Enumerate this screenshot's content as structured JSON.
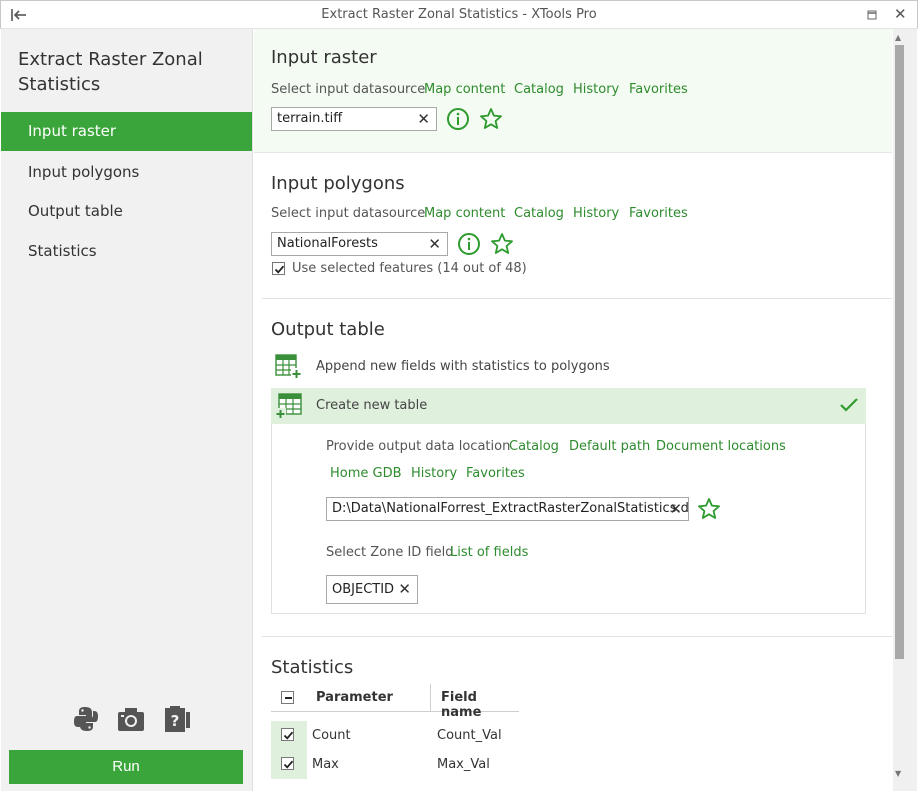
{
  "window": {
    "title": "Extract Raster Zonal Statistics - XTools Pro"
  },
  "sidebar": {
    "heading": "Extract Raster Zonal Statistics",
    "items": [
      {
        "label": "Input raster",
        "active": true
      },
      {
        "label": "Input polygons"
      },
      {
        "label": "Output table"
      },
      {
        "label": "Statistics"
      }
    ],
    "icons": [
      "python-icon",
      "camera-icon",
      "help-clipboard-icon"
    ],
    "run_label": "Run"
  },
  "input_raster": {
    "title": "Input raster",
    "select_label": "Select input datasource",
    "links": [
      "Map content",
      "Catalog",
      "History",
      "Favorites"
    ],
    "value": "terrain.tiff"
  },
  "input_polygons": {
    "title": "Input polygons",
    "select_label": "Select input datasource",
    "links": [
      "Map content",
      "Catalog",
      "History",
      "Favorites"
    ],
    "value": "NationalForests",
    "use_selected_label": "Use selected features (14 out of 48)",
    "use_selected_checked": true
  },
  "output_table": {
    "title": "Output table",
    "option_append": "Append new fields with statistics to polygons",
    "option_create": "Create new table",
    "location_label": "Provide output data location",
    "location_links": [
      "Catalog",
      "Default path",
      "Document locations",
      "Home GDB",
      "History",
      "Favorites"
    ],
    "path_value": "D:\\Data\\NationalForrest_ExtractRasterZonalStatistics.dbf",
    "zone_label": "Select Zone ID field",
    "zone_link": "List of fields",
    "zone_value": "OBJECTID"
  },
  "statistics": {
    "title": "Statistics",
    "col_parameter": "Parameter",
    "col_field": "Field name",
    "rows": [
      {
        "parameter": "Count",
        "field": "Count_Val",
        "checked": true
      },
      {
        "parameter": "Max",
        "field": "Max_Val",
        "checked": true
      }
    ]
  },
  "colors": {
    "accent": "#3aa53a",
    "link": "#2e8b2e",
    "selected_bg": "#dff1dd"
  }
}
